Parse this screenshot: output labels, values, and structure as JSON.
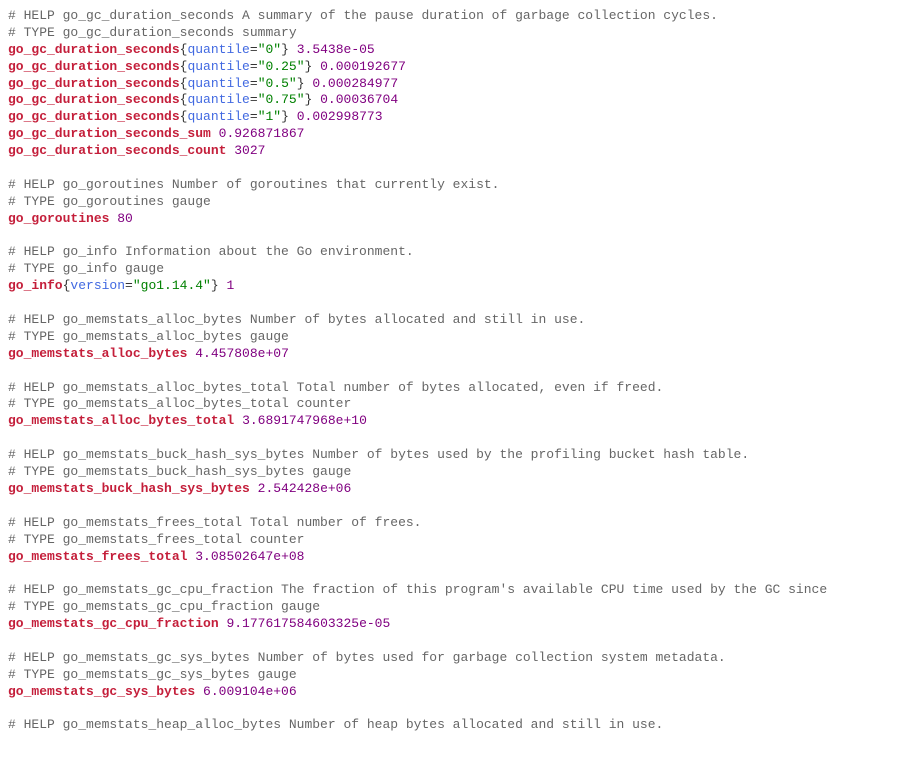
{
  "lines": [
    {
      "type": "comment",
      "text": "# HELP go_gc_duration_seconds A summary of the pause duration of garbage collection cycles."
    },
    {
      "type": "comment",
      "text": "# TYPE go_gc_duration_seconds summary"
    },
    {
      "type": "metric_labeled",
      "name": "go_gc_duration_seconds",
      "label_key": "quantile",
      "label_val": "\"0\"",
      "value": "3.5438e-05"
    },
    {
      "type": "metric_labeled",
      "name": "go_gc_duration_seconds",
      "label_key": "quantile",
      "label_val": "\"0.25\"",
      "value": "0.000192677"
    },
    {
      "type": "metric_labeled",
      "name": "go_gc_duration_seconds",
      "label_key": "quantile",
      "label_val": "\"0.5\"",
      "value": "0.000284977"
    },
    {
      "type": "metric_labeled",
      "name": "go_gc_duration_seconds",
      "label_key": "quantile",
      "label_val": "\"0.75\"",
      "value": "0.00036704"
    },
    {
      "type": "metric_labeled",
      "name": "go_gc_duration_seconds",
      "label_key": "quantile",
      "label_val": "\"1\"",
      "value": "0.002998773"
    },
    {
      "type": "metric_simple",
      "name": "go_gc_duration_seconds_sum",
      "value": "0.926871867"
    },
    {
      "type": "metric_simple",
      "name": "go_gc_duration_seconds_count",
      "value": "3027"
    },
    {
      "type": "blank"
    },
    {
      "type": "comment",
      "text": "# HELP go_goroutines Number of goroutines that currently exist."
    },
    {
      "type": "comment",
      "text": "# TYPE go_goroutines gauge"
    },
    {
      "type": "metric_simple",
      "name": "go_goroutines",
      "value": "80"
    },
    {
      "type": "blank"
    },
    {
      "type": "comment",
      "text": "# HELP go_info Information about the Go environment."
    },
    {
      "type": "comment",
      "text": "# TYPE go_info gauge"
    },
    {
      "type": "metric_labeled",
      "name": "go_info",
      "label_key": "version",
      "label_val": "\"go1.14.4\"",
      "value": "1"
    },
    {
      "type": "blank"
    },
    {
      "type": "comment",
      "text": "# HELP go_memstats_alloc_bytes Number of bytes allocated and still in use."
    },
    {
      "type": "comment",
      "text": "# TYPE go_memstats_alloc_bytes gauge"
    },
    {
      "type": "metric_simple",
      "name": "go_memstats_alloc_bytes",
      "value": "4.457808e+07"
    },
    {
      "type": "blank"
    },
    {
      "type": "comment",
      "text": "# HELP go_memstats_alloc_bytes_total Total number of bytes allocated, even if freed."
    },
    {
      "type": "comment",
      "text": "# TYPE go_memstats_alloc_bytes_total counter"
    },
    {
      "type": "metric_simple",
      "name": "go_memstats_alloc_bytes_total",
      "value": "3.6891747968e+10"
    },
    {
      "type": "blank"
    },
    {
      "type": "comment",
      "text": "# HELP go_memstats_buck_hash_sys_bytes Number of bytes used by the profiling bucket hash table."
    },
    {
      "type": "comment",
      "text": "# TYPE go_memstats_buck_hash_sys_bytes gauge"
    },
    {
      "type": "metric_simple",
      "name": "go_memstats_buck_hash_sys_bytes",
      "value": "2.542428e+06"
    },
    {
      "type": "blank"
    },
    {
      "type": "comment",
      "text": "# HELP go_memstats_frees_total Total number of frees."
    },
    {
      "type": "comment",
      "text": "# TYPE go_memstats_frees_total counter"
    },
    {
      "type": "metric_simple",
      "name": "go_memstats_frees_total",
      "value": "3.08502647e+08"
    },
    {
      "type": "blank"
    },
    {
      "type": "comment",
      "text": "# HELP go_memstats_gc_cpu_fraction The fraction of this program's available CPU time used by the GC since"
    },
    {
      "type": "comment",
      "text": "# TYPE go_memstats_gc_cpu_fraction gauge"
    },
    {
      "type": "metric_simple",
      "name": "go_memstats_gc_cpu_fraction",
      "value": "9.177617584603325e-05"
    },
    {
      "type": "blank"
    },
    {
      "type": "comment",
      "text": "# HELP go_memstats_gc_sys_bytes Number of bytes used for garbage collection system metadata."
    },
    {
      "type": "comment",
      "text": "# TYPE go_memstats_gc_sys_bytes gauge"
    },
    {
      "type": "metric_simple",
      "name": "go_memstats_gc_sys_bytes",
      "value": "6.009104e+06"
    },
    {
      "type": "blank"
    },
    {
      "type": "comment",
      "text": "# HELP go_memstats_heap_alloc_bytes Number of heap bytes allocated and still in use."
    }
  ]
}
